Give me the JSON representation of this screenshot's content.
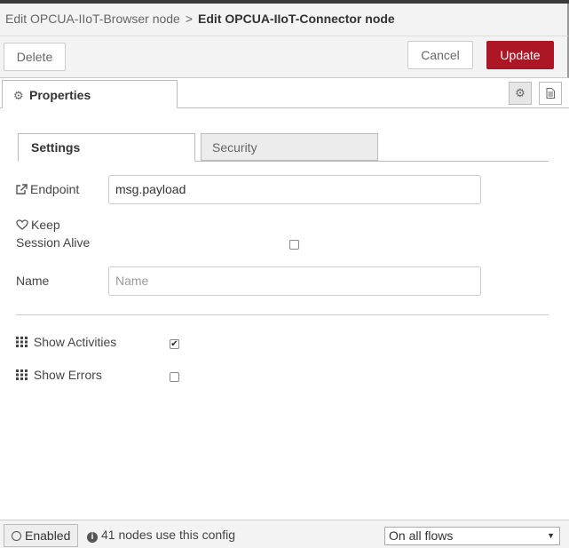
{
  "header": {
    "parent_crumb": "Edit OPCUA-IIoT-Browser node",
    "separator": ">",
    "current_crumb": "Edit OPCUA-IIoT-Connector node"
  },
  "toolbar": {
    "delete_label": "Delete",
    "cancel_label": "Cancel",
    "update_label": "Update",
    "update_color": "#ad1625"
  },
  "tabs": {
    "properties_label": "Properties",
    "properties_icon": "gear-icon",
    "side_buttons": [
      "gear-icon",
      "document-icon"
    ]
  },
  "subtabs": {
    "settings_label": "Settings",
    "security_label": "Security"
  },
  "form": {
    "endpoint": {
      "label": "Endpoint",
      "icon": "external-link-icon",
      "value": "msg.payload"
    },
    "keep_alive": {
      "label_line1": "Keep",
      "label_line2": "Session Alive",
      "icon": "heart-icon",
      "checked": false
    },
    "name": {
      "label": "Name",
      "value": "",
      "placeholder": "Name"
    },
    "show_activities": {
      "label": "Show Activities",
      "icon": "grid-icon",
      "checked": true
    },
    "show_errors": {
      "label": "Show Errors",
      "icon": "grid-icon",
      "checked": false
    }
  },
  "footer": {
    "enabled_label": "Enabled",
    "usage_text": "41 nodes use this config",
    "scope_value": "On all flows"
  }
}
